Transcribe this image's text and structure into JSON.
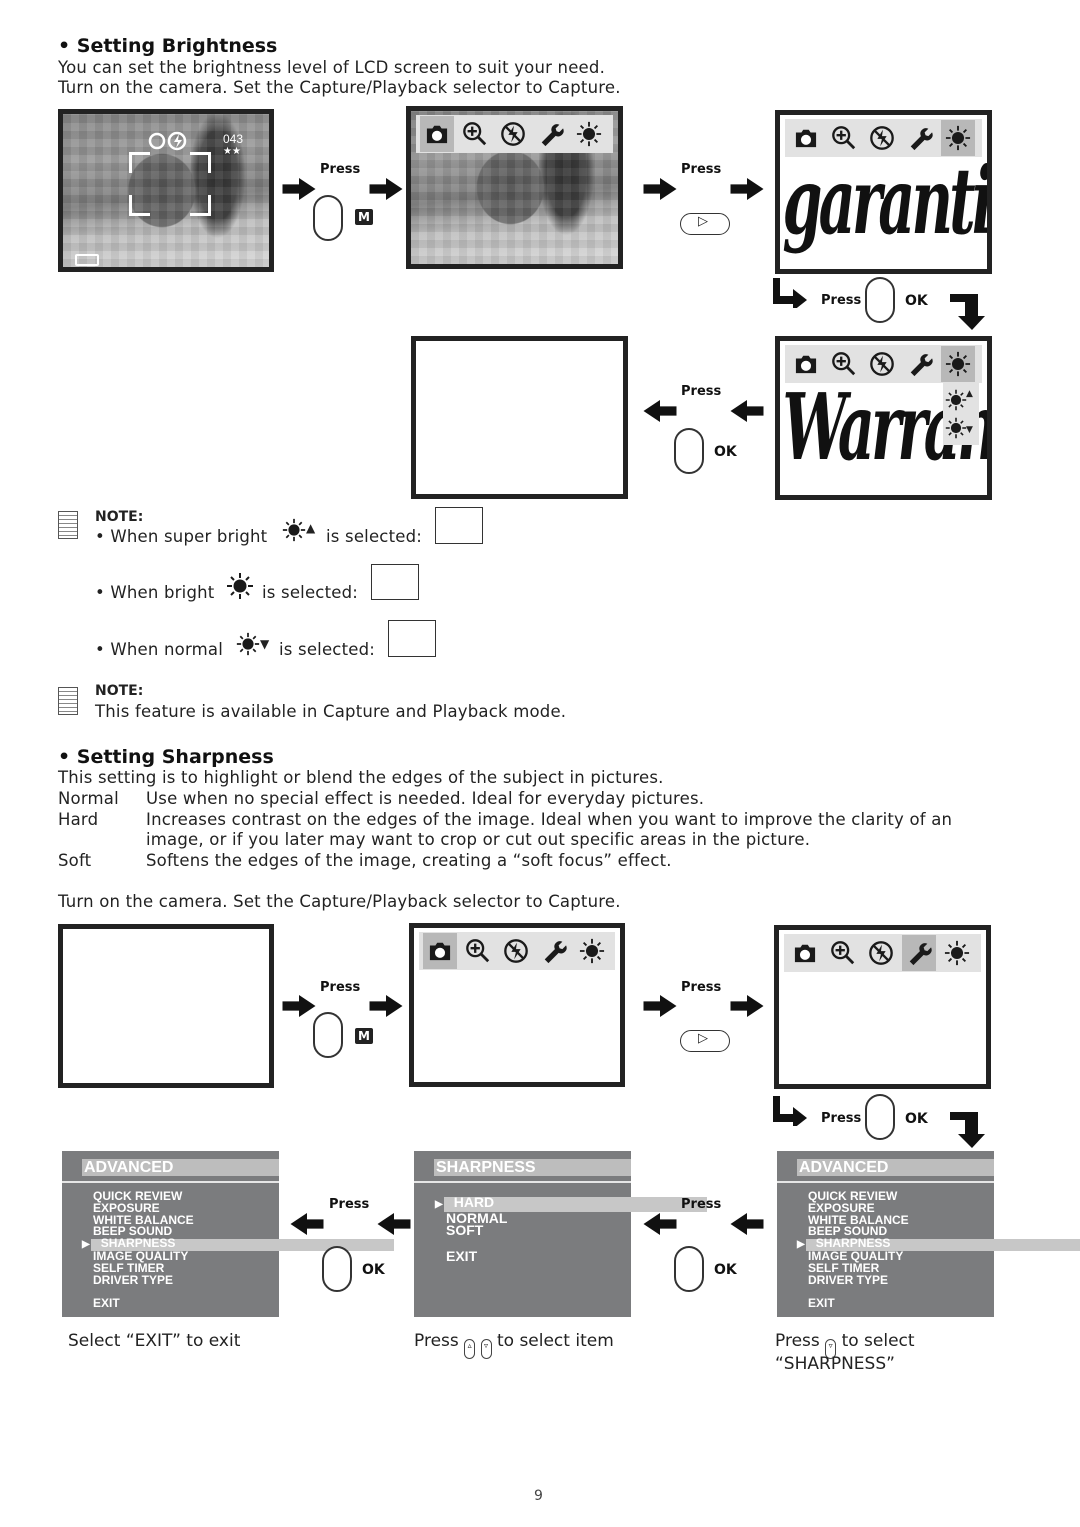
{
  "brightness": {
    "heading": "• Setting Brightness",
    "intro": "You can set the brightness level of LCD screen to suit your need.",
    "instruction": "Turn on the camera.  Set the Capture/Playback selector to Capture.",
    "lcd1": {
      "shot_count": "043",
      "quality_stars": "★★"
    },
    "steps": {
      "press_label": "Press",
      "ok_label": "OK",
      "m_label": "M",
      "play_symbol": "▷"
    },
    "lcd_text_1": "garantie",
    "lcd_text_2": "Warranty",
    "note1": {
      "label": "NOTE:",
      "lines": [
        {
          "prefix": "• When super bright",
          "suffix": "is selected:"
        },
        {
          "prefix": "• When bright",
          "suffix": "is selected:"
        },
        {
          "prefix": "• When normal",
          "suffix": "is selected:"
        }
      ]
    },
    "note2": {
      "label": "NOTE:",
      "text": "This feature is available in Capture and Playback mode."
    }
  },
  "sharpness": {
    "heading": "• Setting Sharpness",
    "intro": "This setting is to highlight or blend the edges of the subject in pictures.",
    "definitions": [
      {
        "term": "Normal",
        "desc": "Use when no special effect is needed.  Ideal for everyday pictures."
      },
      {
        "term": "Hard",
        "desc": "Increases contrast on the edges of the image.  Ideal when you want to improve the clarity of an"
      },
      {
        "term": "",
        "desc": "image, or if you later may want to crop or cut out specific areas in the picture."
      },
      {
        "term": "Soft",
        "desc": "Softens the edges of the image, creating a “soft focus” effect."
      }
    ],
    "instruction": "Turn on the camera.  Set the Capture/Playback selector to Capture.",
    "advanced_menu": {
      "title": "ADVANCED",
      "items": [
        "QUICK REVIEW",
        "EXPOSURE",
        "WHITE BALANCE",
        "BEEP SOUND",
        "SHARPNESS",
        "IMAGE QUALITY",
        "SELF TIMER",
        "DRIVER TYPE"
      ],
      "selected": "SHARPNESS",
      "exit": "EXIT"
    },
    "sharpness_menu": {
      "title": "SHARPNESS",
      "items": [
        "HARD",
        "NORMAL",
        "SOFT"
      ],
      "selected": "HARD",
      "exit": "EXIT"
    },
    "captions": {
      "left": "Select “EXIT” to exit",
      "middle_prefix": "Press",
      "middle_suffix": "to select item",
      "right_prefix": "Press",
      "right_suffix": "to select",
      "right_line2": "“SHARPNESS”"
    }
  },
  "footer": {
    "page_number": "9"
  }
}
